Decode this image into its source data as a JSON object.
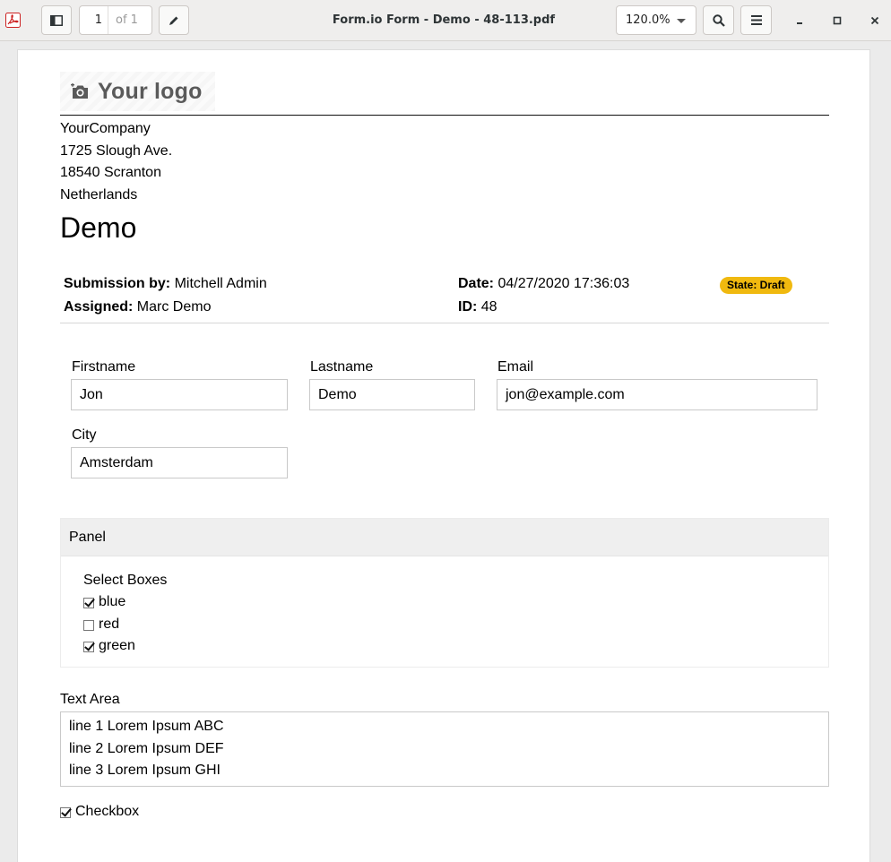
{
  "window": {
    "title": "Form.io Form - Demo - 48-113.pdf",
    "page_current": "1",
    "page_total": "of 1",
    "zoom": "120.0%"
  },
  "doc": {
    "logo_text": "Your logo",
    "company": [
      "YourCompany",
      "1725 Slough Ave.",
      "18540 Scranton",
      "Netherlands"
    ],
    "title": "Demo",
    "meta": {
      "submission_label": "Submission by:",
      "submission_value": "Mitchell Admin",
      "assigned_label": "Assigned:",
      "assigned_value": "Marc Demo",
      "date_label": "Date:",
      "date_value": "04/27/2020 17:36:03",
      "id_label": "ID:",
      "id_value": "48",
      "state": "State: Draft"
    },
    "fields": {
      "firstname_label": "Firstname",
      "firstname_value": "Jon",
      "lastname_label": "Lastname",
      "lastname_value": "Demo",
      "email_label": "Email",
      "email_value": "jon@example.com",
      "city_label": "City",
      "city_value": "Amsterdam"
    },
    "panel": {
      "title": "Panel",
      "select_label": "Select Boxes",
      "options": [
        {
          "label": "blue",
          "checked": true
        },
        {
          "label": "red",
          "checked": false
        },
        {
          "label": "green",
          "checked": true
        }
      ]
    },
    "textarea": {
      "label": "Text Area",
      "lines": [
        "line 1 Lorem Ipsum ABC",
        "line 2 Lorem Ipsum DEF",
        "line 3 Lorem Ipsum GHI"
      ]
    },
    "checkbox": {
      "label": "Checkbox",
      "checked": true
    }
  }
}
